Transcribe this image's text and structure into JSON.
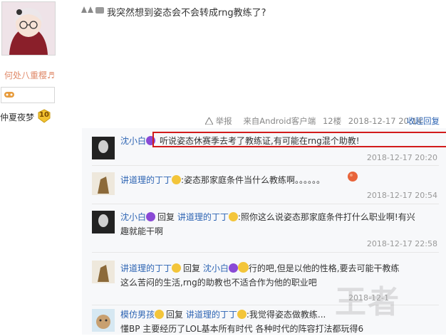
{
  "user": {
    "name": "何处八重樱♬",
    "level_name": "仲夏夜梦",
    "level_number": "10"
  },
  "post": {
    "text": "我突然想到姿态会不会转成rng教练了?",
    "report_label": "举报",
    "client": "来自Android客户端",
    "floor": "12楼",
    "time": "2018-12-17 20:14",
    "collapse_label": "收起回复"
  },
  "replies": [
    {
      "author": "沈小白",
      "text": "听说姿态休赛季去考了教练证,有可能在rng混个助教!",
      "time": "2018-12-17 20:20"
    },
    {
      "author": "讲道理的丁丁",
      "text": ":姿态那家庭条件当什么教练啊。。。。。。",
      "time": "2018-12-17 20:54"
    },
    {
      "author": "沈小白",
      "reply_prefix": "回复",
      "reply_to": "讲道理的丁丁",
      "text_line1": ":照你这么说姿态那家庭条件打什么职业啊!有兴",
      "text_line2": "趣就能干啊",
      "time": "2018-12-17 22:58"
    },
    {
      "author": "讲道理的丁丁",
      "reply_prefix": "回复",
      "reply_to": "沈小白",
      "text_line1": "行的吧,但是以他的性格,要去可能干教练",
      "text_line2": "这么苦闷的生活,rng的助教也不适合作为他的职业吧",
      "time": "2018-12-1"
    },
    {
      "author": "模仿男孩",
      "reply_prefix": "回复",
      "reply_to": "讲道理的丁丁",
      "text_line1": ":我觉得姿态做教练...",
      "text_line2": "懂BP 主要经历了LOL基本所有时代 各种时代的阵容打法都玩得6",
      "time": ""
    }
  ],
  "watermark": "王者"
}
